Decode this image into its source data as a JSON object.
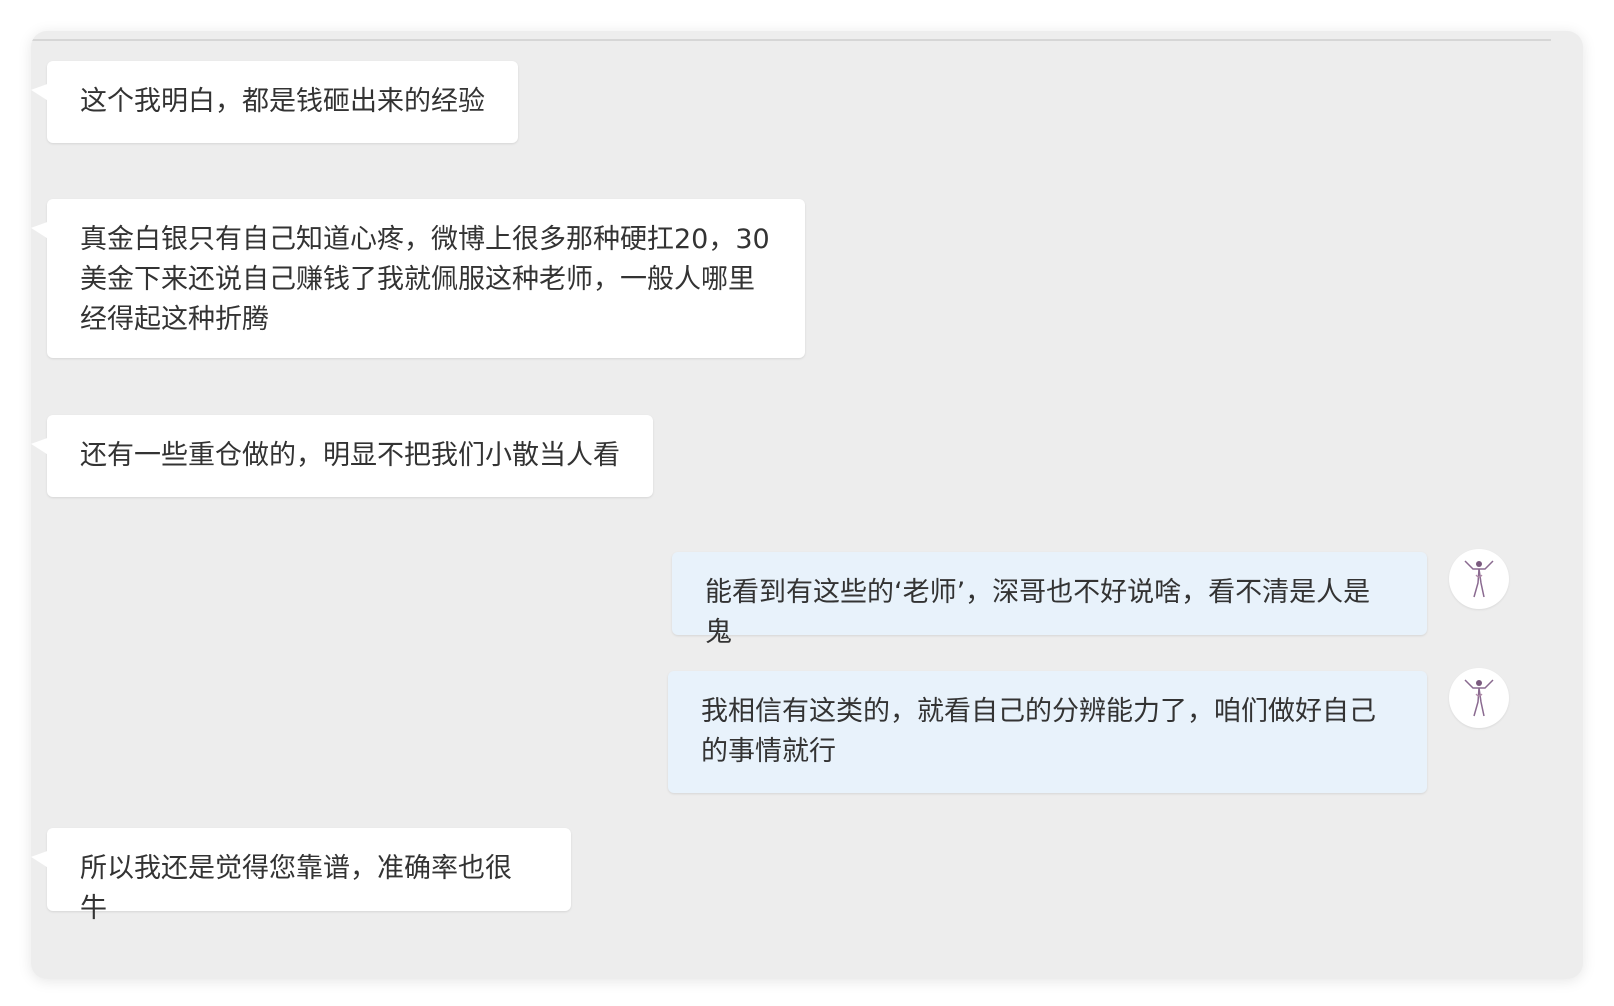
{
  "messages": [
    {
      "side": "in",
      "text": "这个我明白，都是钱砸出来的经验"
    },
    {
      "side": "in",
      "text": "真金白银只有自己知道心疼，微博上很多那种硬扛20，30美金下来还说自己赚钱了我就佩服这种老师，一般人哪里经得起这种折腾"
    },
    {
      "side": "in",
      "text": "还有一些重仓做的，明显不把我们小散当人看"
    },
    {
      "side": "out",
      "text": "能看到有这些的‘老师’，深哥也不好说啥，看不清是人是鬼"
    },
    {
      "side": "out",
      "text": "我相信有这类的，就看自己的分辨能力了，咱们做好自己的事情就行"
    },
    {
      "side": "in",
      "text": "所以我还是觉得您靠谱，准确率也很牛"
    }
  ],
  "colors": {
    "panel_bg": "#ededed",
    "incoming_bubble": "#ffffff",
    "outgoing_bubble": "#e8f2fb",
    "text": "#333333"
  },
  "icons": {
    "avatar": "dancer-figure-avatar-icon"
  }
}
